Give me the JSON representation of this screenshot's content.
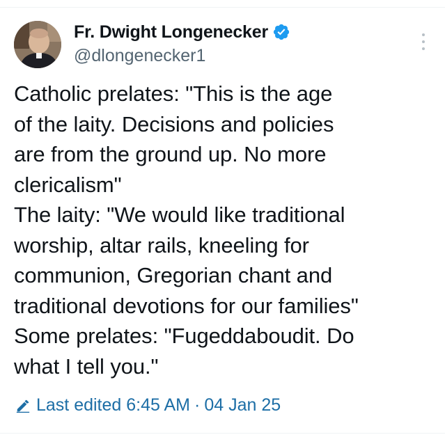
{
  "author": {
    "display_name": "Fr. Dwight Longenecker",
    "handle": "@dlongenecker1",
    "verified": true
  },
  "tweet": {
    "lines": [
      "Catholic prelates: \"This is the age",
      "of the laity. Decisions and policies",
      "are from the ground up. No more",
      "clericalism\"",
      "The laity: \"We would like traditional",
      "worship, altar rails, kneeling for",
      "communion, Gregorian chant and",
      "traditional devotions for our families\"",
      "Some prelates: \"Fugeddaboudit. Do",
      "what I tell you.\""
    ]
  },
  "edit_info": {
    "label": "Last edited 6:45 AM",
    "separator": "·",
    "date": "04 Jan 25"
  },
  "icons": {
    "verified": "verified-badge-icon",
    "more": "more-options-icon",
    "edited": "pencil-icon"
  },
  "colors": {
    "text": "#0f1419",
    "secondary": "#536471",
    "link": "#1d6ea6",
    "verified": "#1d9bf0"
  }
}
